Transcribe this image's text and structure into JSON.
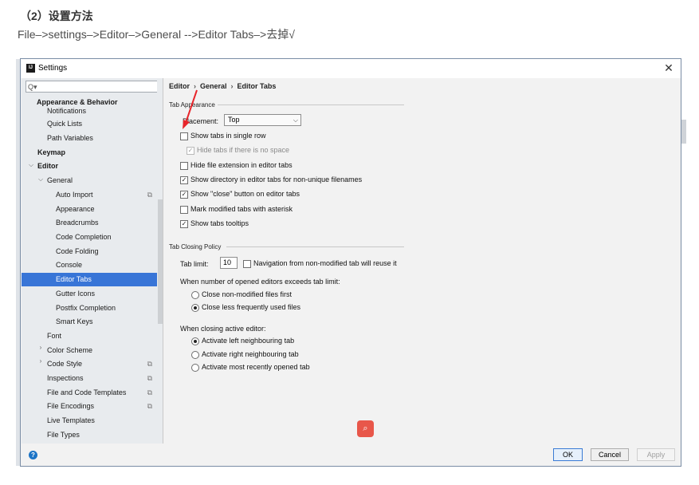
{
  "article": {
    "heading": "（2）设置方法",
    "path_text": "File–>settings–>Editor–>General -->Editor Tabs–>去掉√"
  },
  "dialog": {
    "title": "Settings",
    "app_icon_text": "IJ",
    "close_glyph": "✕"
  },
  "sidebar": {
    "search_placeholder": "Q▾",
    "items": [
      {
        "label": "Appearance & Behavior",
        "bold": true
      },
      {
        "label": "Notifications"
      },
      {
        "label": "Quick Lists"
      },
      {
        "label": "Path Variables"
      },
      {
        "label": "Keymap",
        "bold": true
      },
      {
        "label": "Editor",
        "bold": true
      },
      {
        "label": "General"
      },
      {
        "label": "Auto Import"
      },
      {
        "label": "Appearance"
      },
      {
        "label": "Breadcrumbs"
      },
      {
        "label": "Code Completion"
      },
      {
        "label": "Code Folding"
      },
      {
        "label": "Console"
      },
      {
        "label": "Editor Tabs"
      },
      {
        "label": "Gutter Icons"
      },
      {
        "label": "Postfix Completion"
      },
      {
        "label": "Smart Keys"
      },
      {
        "label": "Font"
      },
      {
        "label": "Color Scheme"
      },
      {
        "label": "Code Style"
      },
      {
        "label": "Inspections"
      },
      {
        "label": "File and Code Templates"
      },
      {
        "label": "File Encodings"
      },
      {
        "label": "Live Templates"
      },
      {
        "label": "File Types"
      }
    ]
  },
  "breadcrumb": [
    "Editor",
    "General",
    "Editor Tabs"
  ],
  "tab_appearance": {
    "heading": "Tab Appearance",
    "placement_label": "Placement:",
    "placement_value": "Top",
    "options": [
      {
        "label": "Show tabs in single row",
        "checked": false
      },
      {
        "label": "Hide tabs if there is no space",
        "checked": true,
        "disabled": true
      },
      {
        "label": "Hide file extension in editor tabs",
        "checked": false
      },
      {
        "label": "Show directory in editor tabs for non-unique filenames",
        "checked": true
      },
      {
        "label": "Show \"close\" button on editor tabs",
        "checked": true
      },
      {
        "label": "Mark modified tabs with asterisk",
        "checked": false
      },
      {
        "label": "Show tabs tooltips",
        "checked": true
      }
    ]
  },
  "tab_closing": {
    "heading": "Tab Closing Policy",
    "tab_limit_label": "Tab limit:",
    "tab_limit_value": "10",
    "nav_reuse_label": "Navigation from non-modified tab will reuse it",
    "exceeds_label": "When number of opened editors exceeds tab limit:",
    "exceeds_options": [
      {
        "label": "Close non-modified files first",
        "selected": false
      },
      {
        "label": "Close less frequently used files",
        "selected": true
      }
    ],
    "closing_label": "When closing active editor:",
    "closing_options": [
      {
        "label": "Activate left neighbouring tab",
        "selected": true
      },
      {
        "label": "Activate right neighbouring tab",
        "selected": false
      },
      {
        "label": "Activate most recently opened tab",
        "selected": false
      }
    ]
  },
  "footer": {
    "help_glyph": "?",
    "ok_label": "OK",
    "cancel_label": "Cancel",
    "apply_label": "Apply"
  },
  "glyphs": {
    "check": "✓",
    "copy": "⧉",
    "caret_down": "⌵",
    "caret_right": "›",
    "select_arrow": "⌵",
    "search": "⌕"
  },
  "colors": {
    "selection": "#3875d7",
    "annotation_arrow": "#e8252b",
    "search_fab": "#e8574a"
  }
}
